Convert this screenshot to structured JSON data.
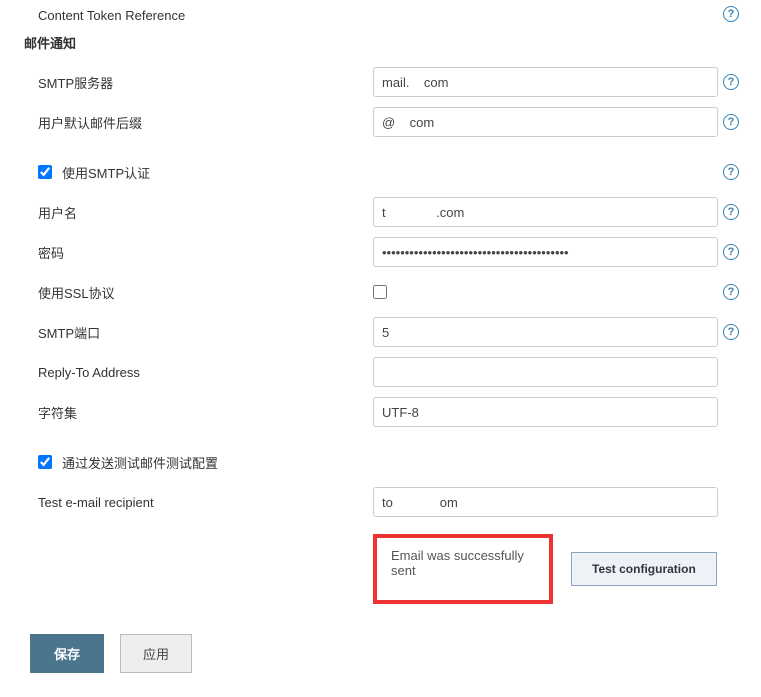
{
  "top_item": {
    "label": "Content Token Reference"
  },
  "section_heading": "邮件通知",
  "fields": {
    "smtp_server": {
      "label": "SMTP服务器",
      "value": "mail.    com"
    },
    "default_suffix": {
      "label": "用户默认邮件后缀",
      "value": "@    com"
    },
    "use_smtp_auth": {
      "label": "使用SMTP认证",
      "checked": true
    },
    "username": {
      "label": "用户名",
      "value": "t              .com"
    },
    "password": {
      "label": "密码",
      "value": "•••••••••••••••••••••••••••••••••••••••••"
    },
    "use_ssl": {
      "label": "使用SSL协议",
      "checked": false
    },
    "smtp_port": {
      "label": "SMTP端口",
      "value": "5"
    },
    "reply_to": {
      "label": "Reply-To Address",
      "value": ""
    },
    "charset": {
      "label": "字符集",
      "value": "UTF-8"
    },
    "send_test": {
      "label": "通过发送测试邮件测试配置",
      "checked": true
    },
    "test_recipient": {
      "label": "Test e-mail recipient",
      "value": "to             om"
    }
  },
  "test": {
    "status": "Email was successfully sent",
    "button": "Test configuration"
  },
  "buttons": {
    "save": "保存",
    "apply": "应用"
  }
}
